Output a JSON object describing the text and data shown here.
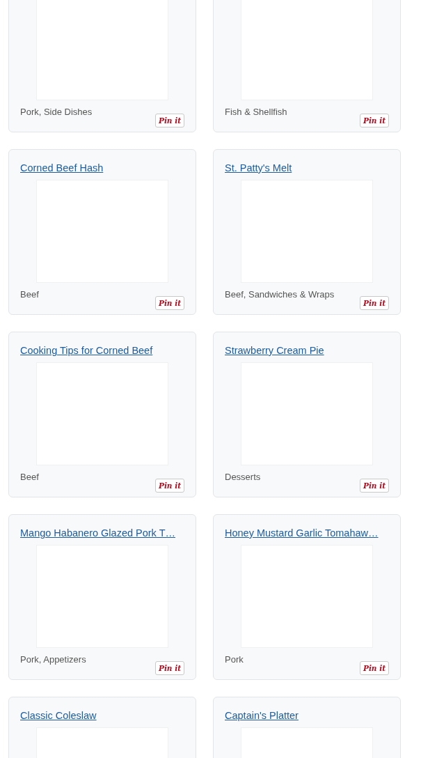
{
  "recipes": [
    {
      "category": "Pork, Side Dishes",
      "pin_label": "Pin it"
    },
    {
      "category": "Fish & Shellfish",
      "pin_label": "Pin it"
    },
    {
      "title": "Corned Beef Hash",
      "category": "Beef",
      "pin_label": "Pin it"
    },
    {
      "title": "St. Patty's Melt",
      "category": "Beef, Sandwiches & Wraps",
      "pin_label": "Pin it"
    },
    {
      "title": "Cooking Tips for Corned Beef",
      "category": "Beef",
      "pin_label": "Pin it"
    },
    {
      "title": "Strawberry Cream Pie",
      "category": "Desserts",
      "pin_label": "Pin it"
    },
    {
      "title": "Mango Habanero Glazed Pork T…",
      "category": "Pork, Appetizers",
      "pin_label": "Pin it"
    },
    {
      "title": "Honey Mustard Garlic Tomahaw…",
      "category": "Pork",
      "pin_label": "Pin it"
    },
    {
      "title": "Classic Coleslaw"
    },
    {
      "title": "Captain's Platter"
    }
  ]
}
